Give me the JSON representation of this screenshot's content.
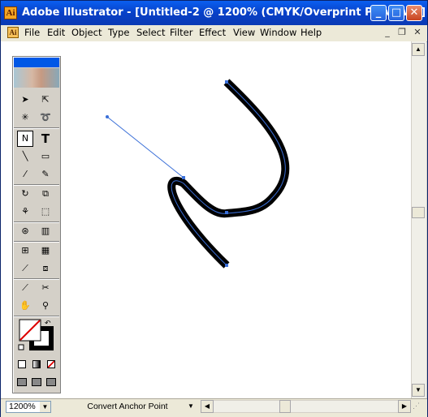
{
  "window": {
    "title": "Adobe Illustrator - [Untitled-2 @ 1200% (CMYK/Overprint Preview) ]",
    "app_icon": "illustrator-icon",
    "controls": {
      "minimize": "_",
      "maximize": "□",
      "close": "✕"
    }
  },
  "menubar": {
    "items": [
      "File",
      "Edit",
      "Object",
      "Type",
      "Select",
      "Filter",
      "Effect",
      "View",
      "Window",
      "Help"
    ],
    "doc_controls": {
      "minimize": "_",
      "restore": "❐",
      "close": "✕"
    }
  },
  "toolbox": {
    "tools": [
      "selection-tool",
      "direct-selection-tool",
      "magic-wand-tool",
      "lasso-tool",
      "pen-tool",
      "type-tool",
      "line-segment-tool",
      "rectangle-tool",
      "paintbrush-tool",
      "pencil-tool",
      "rotate-tool",
      "scale-tool",
      "warp-tool",
      "free-transform-tool",
      "symbol-sprayer-tool",
      "column-graph-tool",
      "mesh-tool",
      "gradient-tool",
      "eyedropper-tool",
      "blend-tool",
      "slice-tool",
      "scissors-tool",
      "hand-tool",
      "zoom-tool"
    ],
    "type_glyph": "T",
    "selected_tool": "convert-anchor-point-tool"
  },
  "artwork": {
    "stroke_color": "#000000",
    "path_color": "#3a6fd8"
  },
  "statusbar": {
    "zoom": "1200%",
    "current_tool": "Convert Anchor Point"
  }
}
